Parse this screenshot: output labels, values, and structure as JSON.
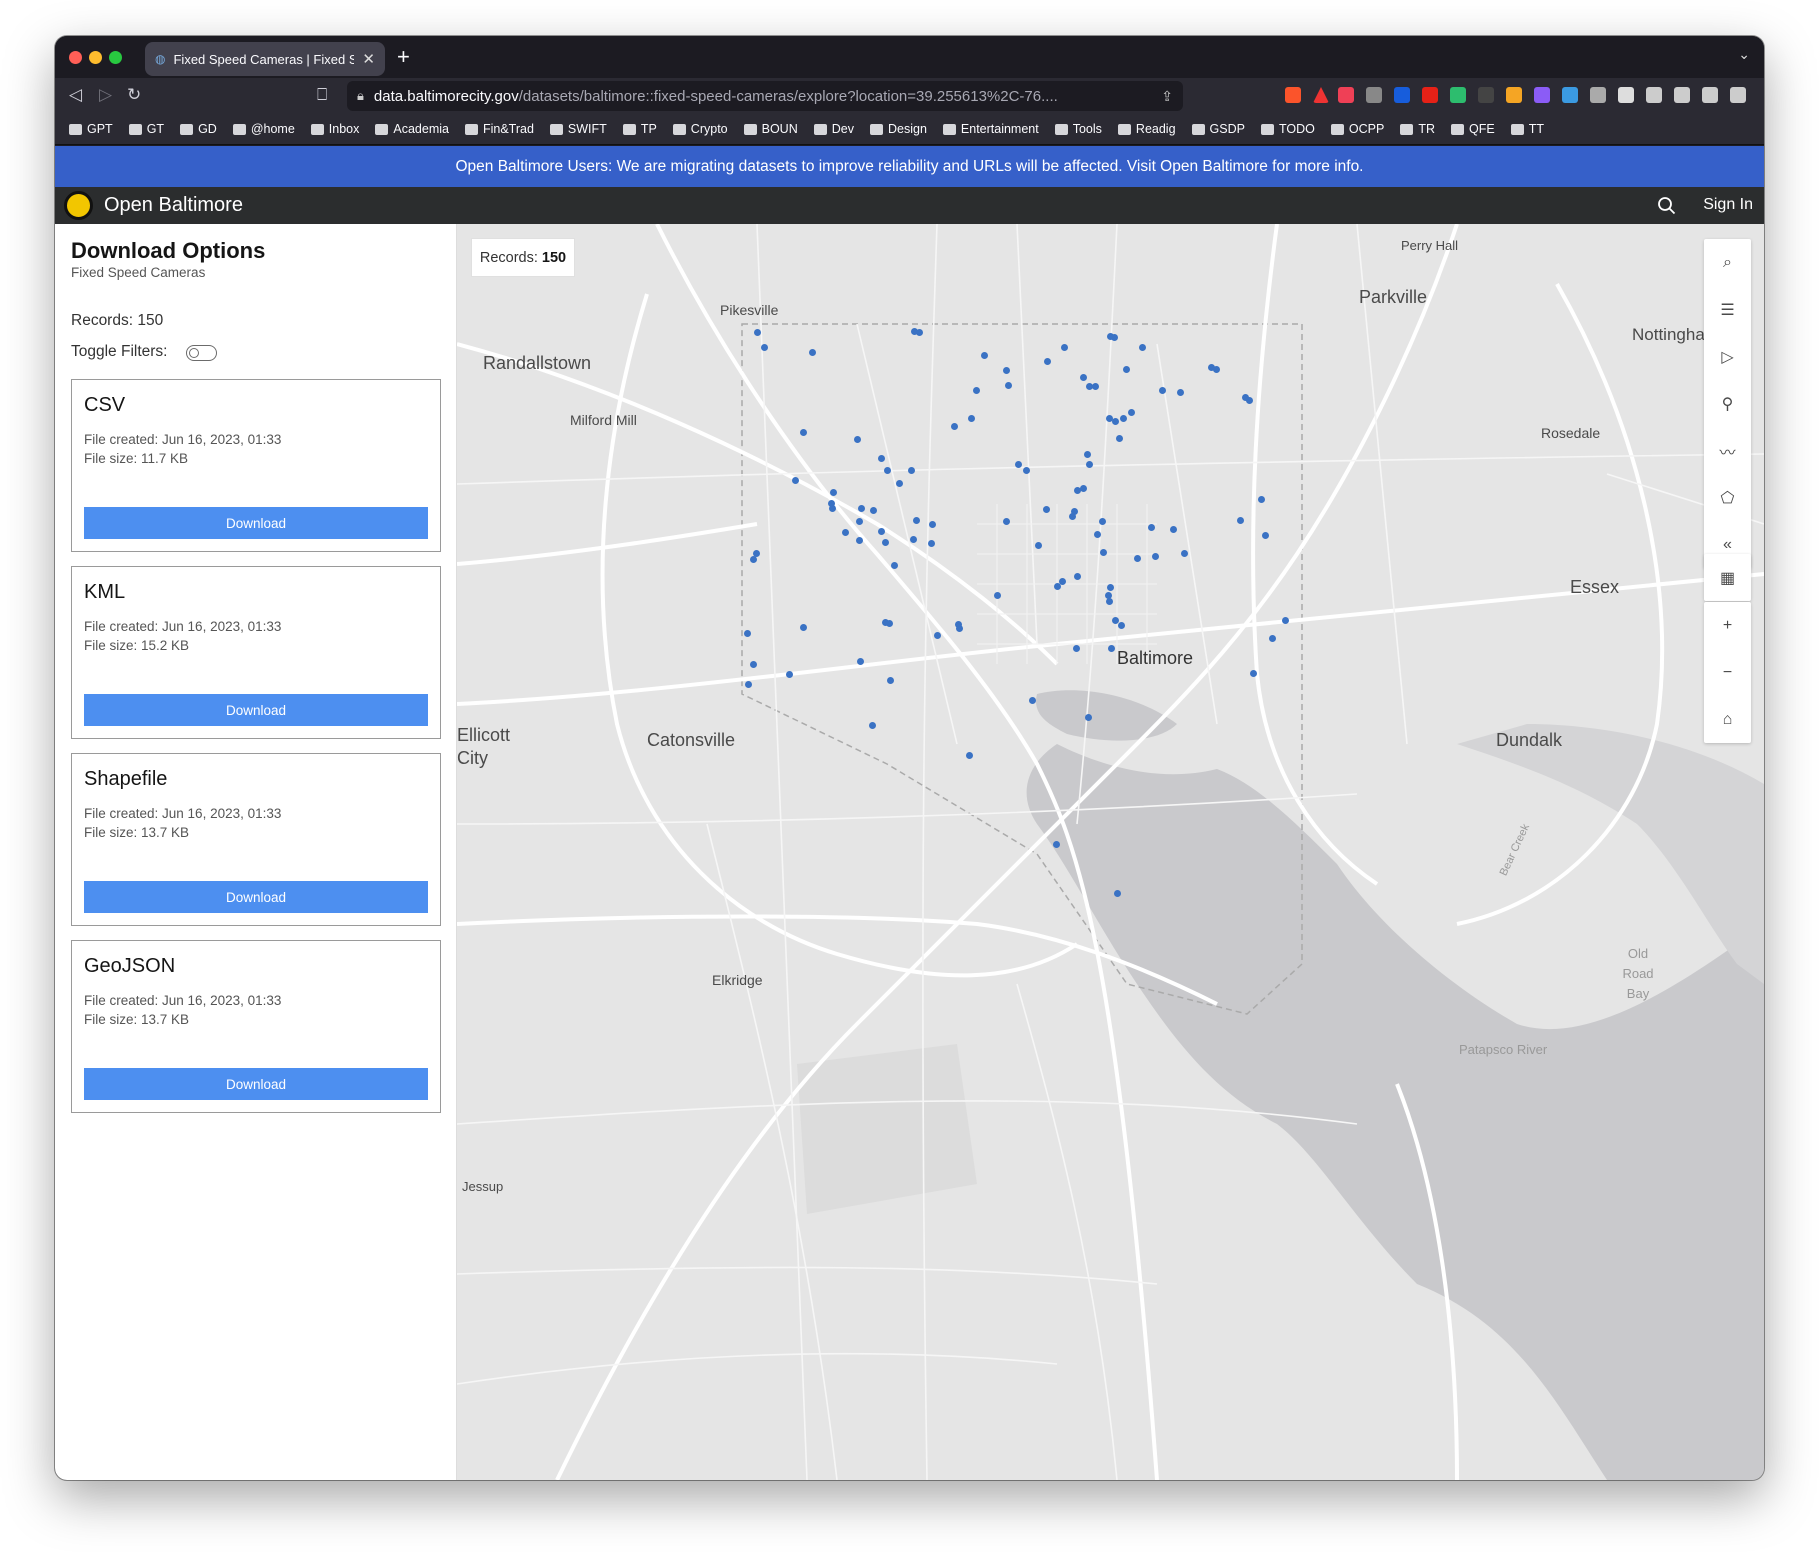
{
  "browser": {
    "tab_title": "Fixed Speed Cameras | Fixed Sp",
    "url_host": "data.baltimorecity.gov",
    "url_path": "/datasets/baltimore::fixed-speed-cameras/explore?location=39.255613%2C-76....",
    "bookmarks": [
      "GPT",
      "GT",
      "GD",
      "@home",
      "Inbox",
      "Academia",
      "Fin&Trad",
      "SWIFT",
      "TP",
      "Crypto",
      "BOUN",
      "Dev",
      "Design",
      "Entertainment",
      "Tools",
      "Readig",
      "GSDP",
      "TODO",
      "OCPP",
      "TR",
      "QFE",
      "TT"
    ]
  },
  "banner": {
    "text": "Open Baltimore Users: We are migrating datasets to improve reliability and URLs will be affected. Visit Open Baltimore for more info."
  },
  "header": {
    "title": "Open Baltimore",
    "sign_in": "Sign In"
  },
  "sidebar": {
    "title": "Download Options",
    "subtitle": "Fixed Speed Cameras",
    "records": "Records: 150",
    "toggle_label": "Toggle Filters:",
    "toggle_on": false,
    "files": [
      {
        "name": "CSV",
        "created": "File created: Jun 16, 2023, 01:33",
        "size": "File size: 11.7 KB",
        "button": "Download"
      },
      {
        "name": "KML",
        "created": "File created: Jun 16, 2023, 01:33",
        "size": "File size: 15.2 KB",
        "button": "Download"
      },
      {
        "name": "Shapefile",
        "created": "File created: Jun 16, 2023, 01:33",
        "size": "File size: 13.7 KB",
        "button": "Download"
      },
      {
        "name": "GeoJSON",
        "created": "File created: Jun 16, 2023, 01:33",
        "size": "File size: 13.7 KB",
        "button": "Download"
      }
    ]
  },
  "map": {
    "records_label": "Records:",
    "records_value": "150",
    "places": [
      "Perry Hall",
      "Pikesville",
      "Parkville",
      "Randallstown",
      "Nottingham",
      "Milford Mill",
      "Rosedale",
      "Essex",
      "Baltimore",
      "Ellicott City",
      "Catonsville",
      "Dundalk",
      "Elkridge",
      "Old Road Bay",
      "Patapsco River",
      "Jessup",
      "Bear Creek"
    ],
    "tools": [
      "search-icon",
      "list-icon",
      "select-icon",
      "pin-icon",
      "polyline-icon",
      "polygon-icon",
      "collapse-icon",
      "table-icon",
      "zoom-in-icon",
      "zoom-out-icon",
      "home-icon"
    ]
  },
  "colors": {
    "banner": "#3660c9",
    "button": "#4d8ff0",
    "point": "#3a72c4",
    "header": "#2b2d2e"
  }
}
